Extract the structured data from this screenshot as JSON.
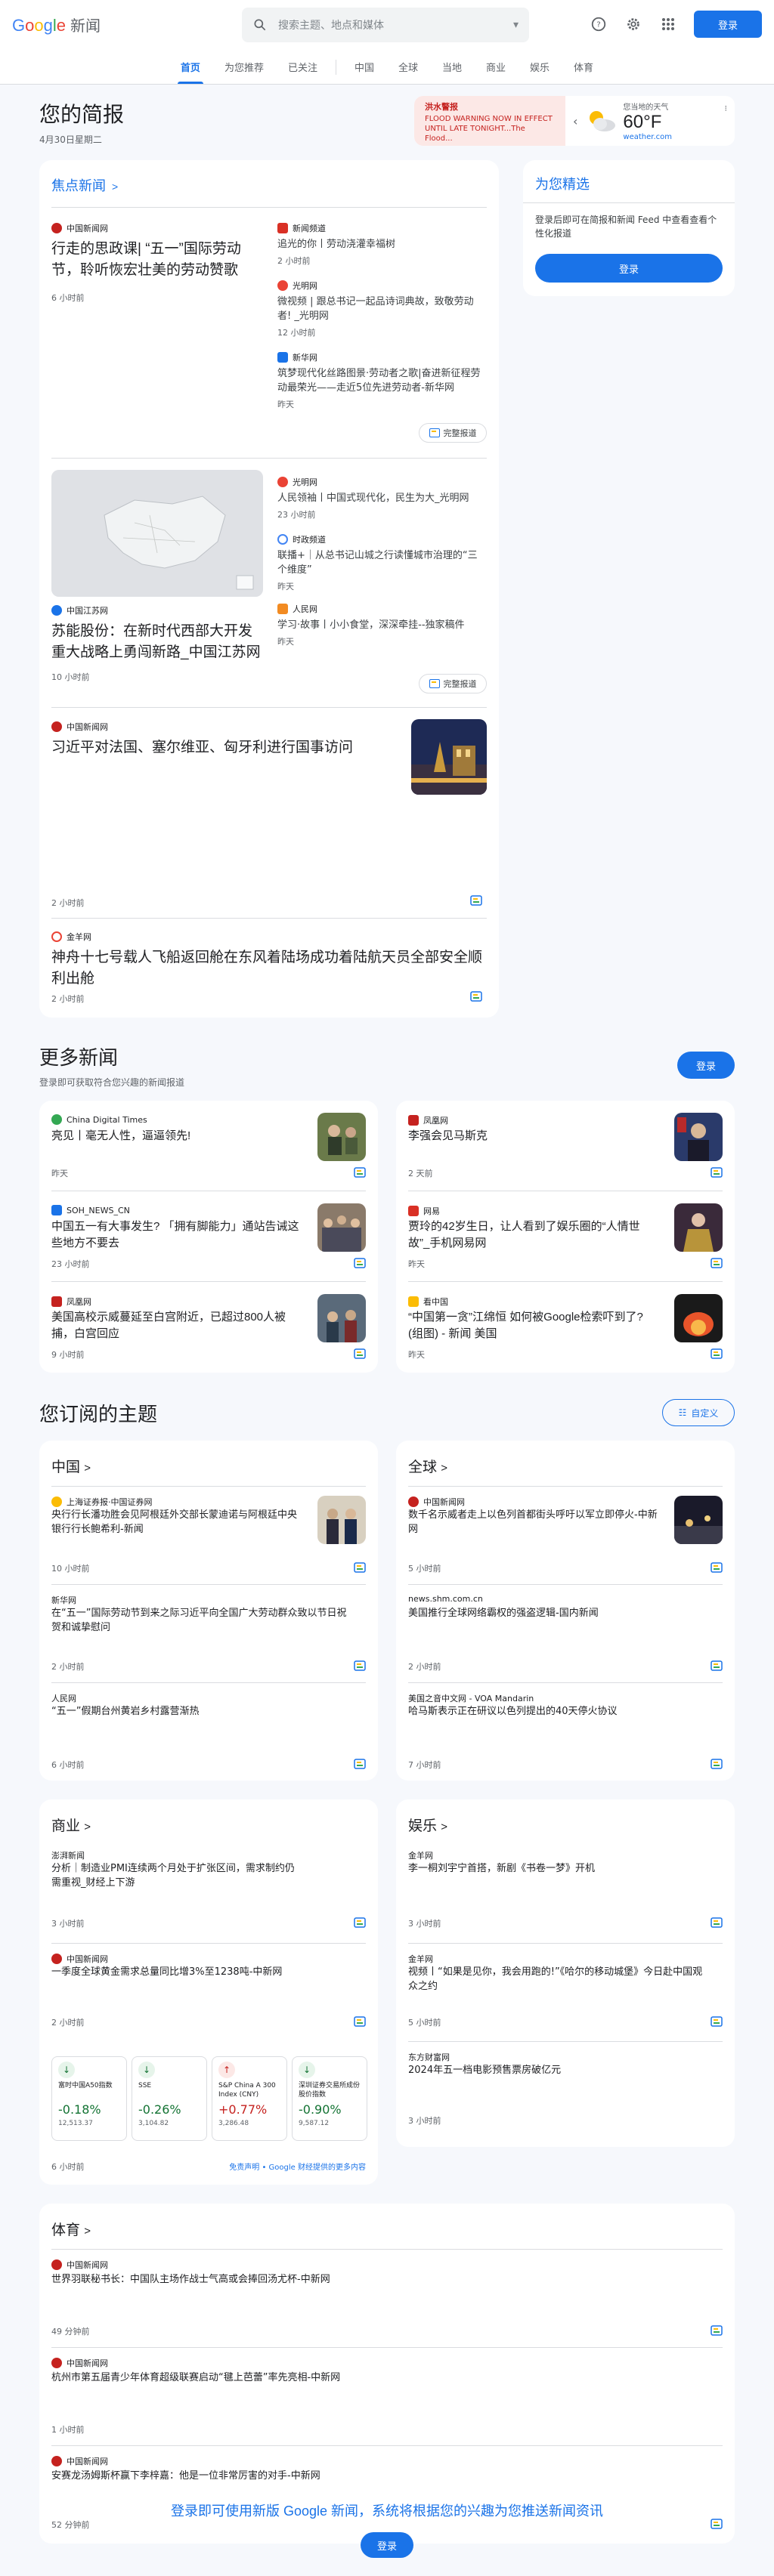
{
  "header": {
    "logo_main": "Google",
    "logo_sub": "新闻",
    "search_placeholder": "搜索主题、地点和媒体",
    "login": "登录",
    "icons": [
      "help-icon",
      "settings-icon",
      "apps-icon"
    ]
  },
  "nav": [
    "首页",
    "为您推荐",
    "已关注",
    "中国",
    "全球",
    "当地",
    "商业",
    "娱乐",
    "体育"
  ],
  "brief": {
    "title": "您的简报",
    "date": "4月30日星期二"
  },
  "weather": {
    "alert_title": "洪水警报",
    "alert_text": "FLOOD WARNING NOW IN EFFECT UNTIL LATE TONIGHT...The Flood...",
    "label": "您当地的天气",
    "temp": "60°F",
    "source": "weather.com"
  },
  "top_stories": {
    "title": "焦点新闻",
    "full_coverage": "完整报道",
    "c1": {
      "main": {
        "source": "中国新闻网",
        "headline": "行走的思政课| “五一”国际劳动节，聆听恢宏壮美的劳动赞歌",
        "time": "6 小时前"
      },
      "side": [
        {
          "source": "新闻频道",
          "headline": "追光的你丨劳动浇灌幸福树",
          "time": "2 小时前"
        },
        {
          "source": "光明网",
          "headline": "微视频 | 跟总书记一起品诗词典故，致敬劳动者! _光明网",
          "time": "12 小时前"
        },
        {
          "source": "新华网",
          "headline": "筑梦现代化丝路图景·劳动者之歌|奋进新征程劳动最荣光——走近5位先进劳动者-新华网",
          "time": "昨天"
        }
      ]
    },
    "c2": {
      "main": {
        "source": "中国江苏网",
        "headline": "苏能股份：在新时代西部大开发重大战略上勇闯新路_中国江苏网",
        "time": "10 小时前"
      },
      "side": [
        {
          "source": "光明网",
          "headline": "人民领袖丨中国式现代化，民生为大_光明网",
          "time": "23 小时前"
        },
        {
          "source": "时政频道",
          "headline": "联播+｜从总书记山城之行读懂城市治理的“三个维度”",
          "time": "昨天"
        },
        {
          "source": "人民网",
          "headline": "学习·故事丨小小食堂，深深牵挂--独家稿件",
          "time": "昨天"
        }
      ]
    },
    "s3": {
      "source": "中国新闻网",
      "headline": "习近平对法国、塞尔维亚、匈牙利进行国事访问",
      "time": "2 小时前"
    },
    "s4": {
      "source": "金羊网",
      "headline": "神舟十七号载人飞船返回舱在东风着陆场成功着陆航天员全部安全顺利出舱",
      "time": "2 小时前"
    }
  },
  "picks": {
    "title": "为您精选",
    "text": "登录后即可在简报和新闻 Feed 中查看查看个性化报道",
    "button": "登录"
  },
  "more": {
    "title": "更多新闻",
    "subtitle": "登录即可获取符合您兴趣的新闻报道",
    "login": "登录",
    "left": [
      {
        "source": "China Digital Times",
        "headline": "亮见丨毫无人性，逼逼领先!",
        "time": "昨天"
      },
      {
        "source": "SOH_NEWS_CN",
        "headline": "中国五一有大事发生? 「拥有脚能力」通站告诫这些地方不要去",
        "time": "23 小时前"
      },
      {
        "source": "凤凰网",
        "headline": "美国高校示威蔓延至白宫附近，已超过800人被捕，白宫回应",
        "time": "9 小时前"
      }
    ],
    "right": [
      {
        "source": "凤凰网",
        "headline": "李强会见马斯克",
        "time": "2 天前"
      },
      {
        "source": "网易",
        "headline": "贾玲的42岁生日，让人看到了娱乐圈的“人情世故”_手机网易网",
        "time": "昨天"
      },
      {
        "source": "看中国",
        "headline": "“中国第一贪”江绵恒 如何被Google检索吓到了? (组图) - 新闻 美国",
        "time": "昨天"
      }
    ]
  },
  "topics": {
    "title": "您订阅的主题",
    "customize": "自定义",
    "china": {
      "title": "中国",
      "items": [
        {
          "source": "上海证券报·中国证券网",
          "headline": "央行行长潘功胜会见阿根廷外交部长蒙迪诺与阿根廷中央银行行长鲍希利-新闻",
          "time": "10 小时前"
        },
        {
          "source": "新华网",
          "headline": "在“五一”国际劳动节到来之际习近平向全国广大劳动群众致以节日祝贺和诚挚慰问",
          "time": "2 小时前"
        },
        {
          "source": "人民网",
          "headline": "“五一”假期台州黄岩乡村露营渐热",
          "time": "6 小时前"
        }
      ]
    },
    "world": {
      "title": "全球",
      "items": [
        {
          "source": "中国新闻网",
          "headline": "数千名示威者走上以色列首都街头呼吁以军立即停火-中新网",
          "time": "5 小时前"
        },
        {
          "source": "news.shm.com.cn",
          "headline": "美国推行全球网络霸权的强盗逻辑-国内新闻",
          "time": "2 小时前"
        },
        {
          "source": "美国之音中文网 - VOA Mandarin",
          "headline": "哈马斯表示正在研议以色列提出的40天停火协议",
          "time": "7 小时前"
        }
      ]
    },
    "business": {
      "title": "商业",
      "items": [
        {
          "source": "澎湃新闻",
          "headline": "分析｜制造业PMI连续两个月处于扩张区间，需求制约仍需重视_财经上下游",
          "time": "3 小时前"
        },
        {
          "source": "中国新闻网",
          "headline": "一季度全球黄金需求总量同比增3%至1238吨-中新网",
          "time": "2 小时前"
        }
      ],
      "stocks": [
        {
          "arrow": "down",
          "name": "富时中国A50指数",
          "pct": "-0.18%",
          "val": "12,513.37"
        },
        {
          "arrow": "down",
          "name": "SSE",
          "pct": "-0.26%",
          "val": "3,104.82"
        },
        {
          "arrow": "up",
          "name": "S&P China A 300 Index (CNY)",
          "pct": "+0.77%",
          "val": "3,286.48"
        },
        {
          "arrow": "down",
          "name": "深圳证券交易所成份股价指数",
          "pct": "-0.90%",
          "val": "9,587.12"
        }
      ],
      "disclaimer": "免责声明 • Google 财经提供的更多内容",
      "last_time": "6 小时前"
    },
    "ent": {
      "title": "娱乐",
      "items": [
        {
          "source": "金羊网",
          "headline": "李一桐刘宇宁首搭，新剧《书卷一梦》开机",
          "time": "3 小时前"
        },
        {
          "source": "金羊网",
          "headline": "视频丨“如果是见你，我会用跑的!”《哈尔的移动城堡》今日赴中国观众之约",
          "time": "5 小时前"
        },
        {
          "source": "东方财富网",
          "headline": "2024年五一档电影预售票房破亿元",
          "time": "3 小时前"
        }
      ]
    },
    "sports": {
      "title": "体育",
      "items": [
        {
          "source": "中国新闻网",
          "headline": "世界羽联秘书长：中国队主场作战士气高或会捧回汤尤杯-中新网",
          "time": "49 分钟前"
        },
        {
          "source": "中国新闻网",
          "headline": "杭州市第五届青少年体育超级联赛启动“毽上芭蕾”率先亮相-中新网",
          "time": "1 小时前"
        },
        {
          "source": "中国新闻网",
          "headline": "安赛龙汤姆斯杯赢下李梓嘉：他是一位非常厉害的对手-中新网",
          "time": "52 分钟前"
        }
      ]
    }
  },
  "footer": {
    "text": "登录即可使用新版 Google 新闻，系统将根据您的兴趣为您推送新闻资讯",
    "button": "登录"
  }
}
